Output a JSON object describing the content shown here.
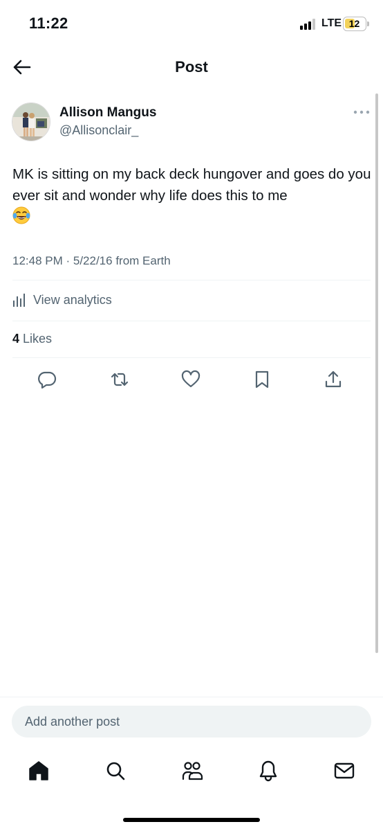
{
  "status_bar": {
    "time": "11:22",
    "network": "LTE",
    "battery": "12"
  },
  "header": {
    "title": "Post",
    "back_icon": "arrow-left-icon"
  },
  "post": {
    "author_name": "Allison Mangus",
    "author_handle": "@Allisonclair_",
    "text": "MK is sitting on my back deck hungover  and goes do you ever sit and wonder why life does this to me",
    "emoji": "😂",
    "timestamp": "12:48 PM · 5/22/16 from Earth",
    "analytics_label": "View analytics",
    "likes_count": "4",
    "likes_label": " Likes"
  },
  "actions": [
    "reply-icon",
    "repost-icon",
    "like-icon",
    "bookmark-icon",
    "share-icon"
  ],
  "reply": {
    "placeholder": "Add another post"
  },
  "tabbar": [
    "home-icon",
    "search-icon",
    "communities-icon",
    "notifications-icon",
    "messages-icon"
  ],
  "colors": {
    "text": "#0f1419",
    "secondary": "#536471",
    "divider": "#eff3f4",
    "battery": "#f2d25a"
  }
}
